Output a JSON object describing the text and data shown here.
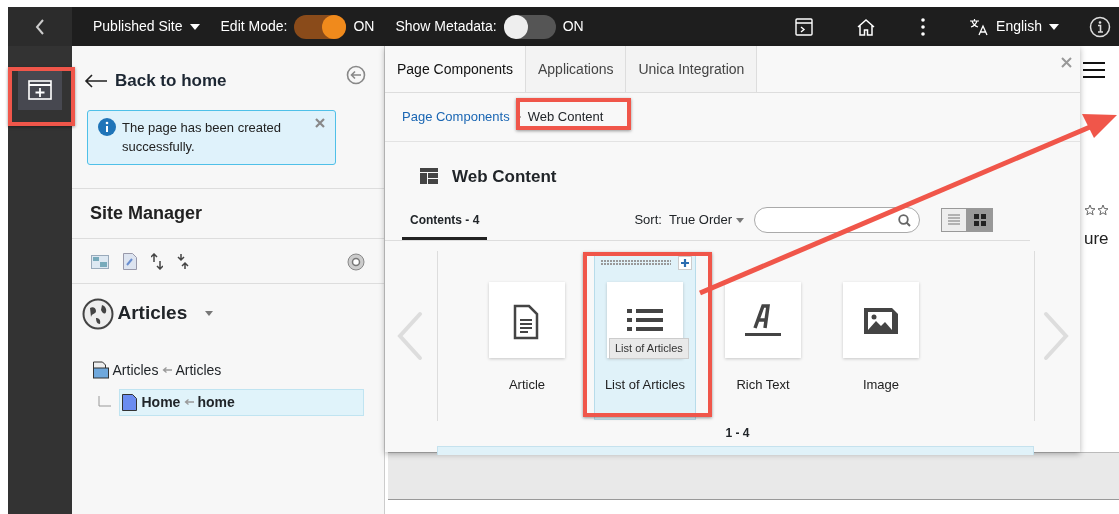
{
  "topbar": {
    "site_menu": "Published Site",
    "toggles": [
      {
        "label": "Edit Mode:",
        "on": true,
        "state_text": "ON"
      },
      {
        "label": "Show Metadata:",
        "on": false,
        "state_text": "ON"
      }
    ],
    "language": "English"
  },
  "side_panel": {
    "back_link": "Back to home",
    "alert": "The page has been created successfully.",
    "title": "Site Manager",
    "site_name": "Articles",
    "tree": [
      {
        "label": "Articles",
        "mapping": "Articles",
        "selected": false,
        "children": [
          {
            "label": "Home",
            "mapping": "home",
            "selected": true
          }
        ]
      }
    ]
  },
  "component_panel": {
    "tabs": [
      {
        "label": "Page Components",
        "selected": true
      },
      {
        "label": "Applications",
        "selected": false
      },
      {
        "label": "Unica Integration",
        "selected": false
      }
    ],
    "breadcrumb": [
      {
        "label": "Page Components",
        "kind": "link"
      },
      {
        "label": "Web Content",
        "kind": "current"
      }
    ],
    "heading": "Web Content",
    "contents_tab": "Contents - 4",
    "sort_label": "Sort:",
    "sort_value": "True Order",
    "views": [
      {
        "kind": "list",
        "selected": false
      },
      {
        "kind": "grid",
        "selected": true
      }
    ],
    "items": [
      {
        "label": "Article",
        "kind": "article",
        "selected": false
      },
      {
        "label": "List of Articles",
        "kind": "list",
        "selected": true,
        "tooltip": "List of Articles"
      },
      {
        "label": "Rich Text",
        "kind": "richtext",
        "selected": false
      },
      {
        "label": "Image",
        "kind": "image",
        "selected": false
      }
    ],
    "pager": "1 - 4"
  },
  "page_behind": {
    "text": "ure"
  }
}
